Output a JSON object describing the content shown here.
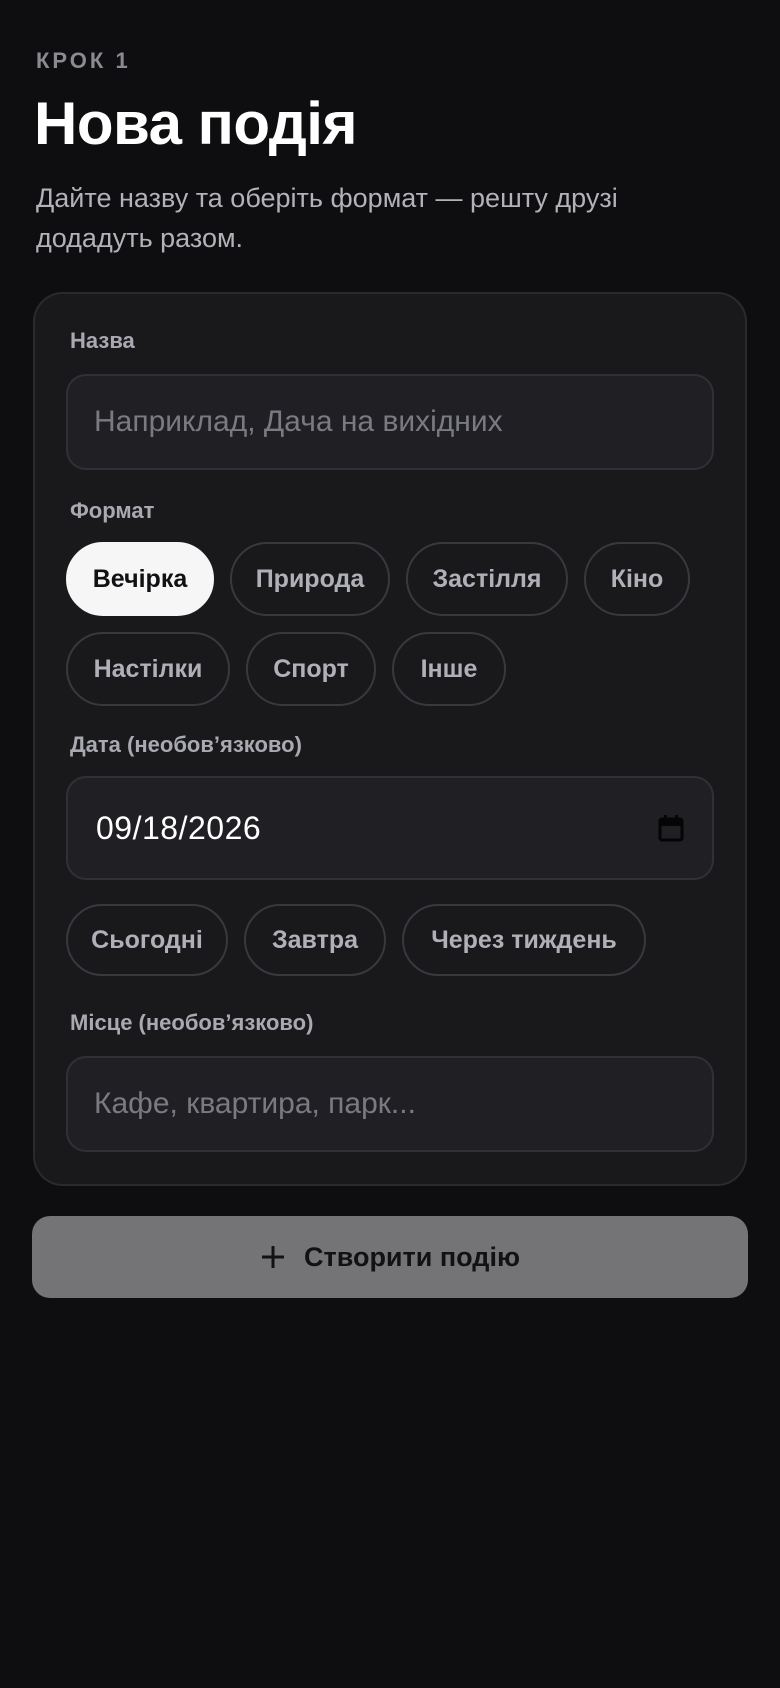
{
  "header": {
    "step": "КРОК 1",
    "title": "Нова подія",
    "subtitle": "Дайте назву та оберіть формат — решту друзі додадуть разом."
  },
  "form": {
    "name": {
      "label": "Назва",
      "placeholder": "Наприклад, Дача на вихідних",
      "value": ""
    },
    "format": {
      "label": "Формат",
      "selected": "Вечірка",
      "options": [
        "Вечірка",
        "Природа",
        "Застілля",
        "Кіно",
        "Настілки",
        "Спорт",
        "Інше"
      ]
    },
    "date": {
      "label": "Дата (необов’язково)",
      "value": "09/18/2026",
      "icon": "calendar-icon",
      "quick_options": [
        "Сьогодні",
        "Завтра",
        "Через тиждень"
      ]
    },
    "place": {
      "label": "Місце (необов’язково)",
      "placeholder": "Кафе, квартира, парк...",
      "value": ""
    }
  },
  "submit": {
    "label": "Створити подію",
    "icon": "plus-icon",
    "enabled": false
  },
  "colors": {
    "background": "#0e0e10",
    "card": "#19191c",
    "selected_chip": "#f6f6f7",
    "button_disabled": "#747476"
  }
}
